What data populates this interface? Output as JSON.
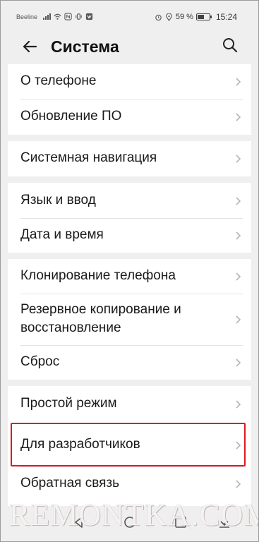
{
  "status_bar": {
    "carrier": "Beeline",
    "battery": "59 %",
    "battery_level": 0.59,
    "time": "15:24",
    "icons": [
      "signal-icon",
      "wifi-icon",
      "nfc-icon",
      "vibrate-icon",
      "app-notification-icon",
      "alarm-icon",
      "location-icon"
    ]
  },
  "header": {
    "title": "Система",
    "back_icon": "arrow-left-icon",
    "search_icon": "search-icon"
  },
  "groups": [
    {
      "items": [
        {
          "label": "О телефоне"
        },
        {
          "label": "Обновление ПО"
        }
      ]
    },
    {
      "items": [
        {
          "label": "Системная навигация"
        }
      ]
    },
    {
      "items": [
        {
          "label": "Язык и ввод"
        },
        {
          "label": "Дата и время"
        }
      ]
    },
    {
      "items": [
        {
          "label": "Клонирование телефона"
        },
        {
          "label": "Резервное копирование и восстановление"
        },
        {
          "label": "Сброс"
        }
      ]
    },
    {
      "items": [
        {
          "label": "Простой режим"
        },
        {
          "label": "Для разработчиков"
        },
        {
          "label": "Обратная связь"
        }
      ]
    }
  ],
  "highlight_color": "#e01922",
  "highlighted_item": "Для разработчиков",
  "watermark": "REMONTKA.COM",
  "nav_bar": {
    "icons": [
      "back-triangle-icon",
      "home-circle-icon",
      "recents-square-icon",
      "download-icon"
    ]
  }
}
